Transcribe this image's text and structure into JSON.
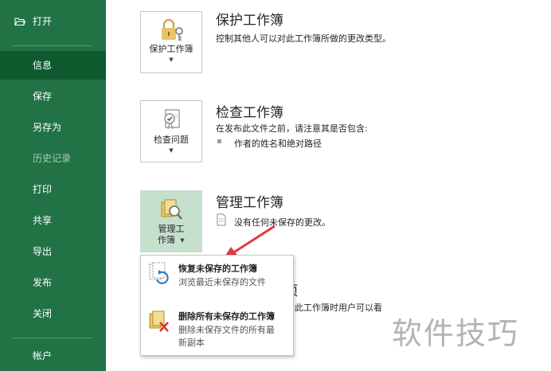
{
  "sidebar": {
    "open_label": "打开",
    "items": [
      {
        "label": "信息"
      },
      {
        "label": "保存"
      },
      {
        "label": "另存为"
      },
      {
        "label": "历史记录"
      },
      {
        "label": "打印"
      },
      {
        "label": "共享"
      },
      {
        "label": "导出"
      },
      {
        "label": "发布"
      },
      {
        "label": "关闭"
      }
    ],
    "account_label": "帐户",
    "colors": {
      "background": "#217346",
      "active": "#0e5a2e"
    }
  },
  "protect": {
    "button_label": "保护工作簿",
    "title": "保护工作簿",
    "description": "控制其他人可以对此工作簿所做的更改类型。"
  },
  "inspect": {
    "button_label": "检查问题",
    "title": "检查工作簿",
    "description": "在发布此文件之前，请注意其是否包含:",
    "bullet": "作者的姓名和绝对路径"
  },
  "manage": {
    "button_label_line1": "管理工",
    "button_label_line2": "作簿",
    "title": "管理工作簿",
    "status": "没有任何未保存的更改。"
  },
  "background_partial": {
    "title_fragment": "选项",
    "text_fragment": "此工作簿时用户可以看"
  },
  "menu": {
    "recover": {
      "title": "恢复未保存的工作簿",
      "description": "浏览最近未保存的文件"
    },
    "delete": {
      "title": "删除所有未保存的工作簿",
      "description": "删除未保存文件的所有最新副本"
    }
  },
  "watermark": "软件技巧",
  "accent_color": "#217346",
  "arrow_color": "#e0393e"
}
